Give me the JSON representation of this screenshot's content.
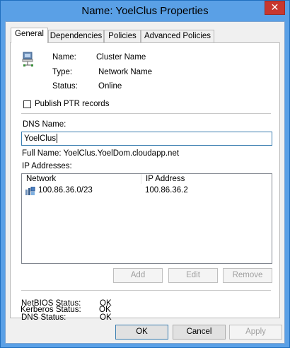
{
  "window": {
    "title": "Name: YoelClus Properties",
    "close_glyph": "✕"
  },
  "tabs": [
    {
      "label": "General",
      "active": true
    },
    {
      "label": "Dependencies",
      "active": false
    },
    {
      "label": "Policies",
      "active": false
    },
    {
      "label": "Advanced Policies",
      "active": false
    }
  ],
  "resource": {
    "icon": "network-name-icon",
    "name_label": "Name:",
    "name_value": "Cluster Name",
    "type_label": "Type:",
    "type_value": "Network Name",
    "status_label": "Status:",
    "status_value": "Online"
  },
  "publish_ptr": {
    "label": "Publish PTR records",
    "checked": false
  },
  "dns": {
    "label": "DNS Name:",
    "value": "YoelClus"
  },
  "full_name": "Full Name: YoelClus.YoelDom.cloudapp.net",
  "ip": {
    "label": "IP Addresses:",
    "columns": [
      "Network",
      "IP Address"
    ],
    "rows": [
      {
        "network": "100.86.36.0/23",
        "address": "100.86.36.2"
      }
    ],
    "add_label": "Add",
    "edit_label": "Edit",
    "remove_label": "Remove"
  },
  "statuses": {
    "netbios_label": "NetBIOS Status:",
    "netbios_value": "OK",
    "dns_label": "DNS Status:",
    "dns_value": "OK",
    "kerberos_label": "Kerberos Status:",
    "kerberos_value": "OK"
  },
  "footer": {
    "ok": "OK",
    "cancel": "Cancel",
    "apply": "Apply"
  }
}
